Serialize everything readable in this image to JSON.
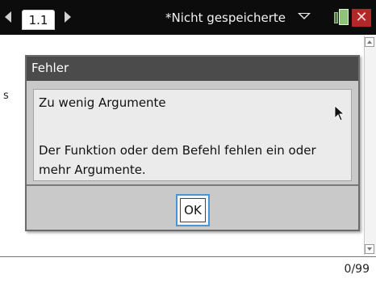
{
  "topbar": {
    "tab_label": "1.1",
    "document_title": "*Nicht gespeicherte"
  },
  "workarea": {
    "prompt_text": "s"
  },
  "dialog": {
    "title": "Fehler",
    "message_heading": "Zu wenig Argumente",
    "message_line1": "Der Funktion oder dem Befehl fehlen ein oder",
    "message_line2": "mehr Argumente.",
    "ok_label": "OK"
  },
  "statusbar": {
    "counter": "0/99"
  },
  "colors": {
    "topbar_bg": "#0c0c0c",
    "dialog_title_bg": "#4b4b4b",
    "dialog_bg": "#c9c9c9",
    "ok_focus_ring": "#4c94d0",
    "close_red": "#b22828",
    "cursor_red": "#c0203a"
  },
  "icons": {
    "nav_left": "chevron-left-icon",
    "nav_right": "chevron-right-icon",
    "doc_menu": "chevron-down-icon",
    "battery": "battery-icon",
    "close": "close-icon",
    "pointer": "mouse-pointer-icon",
    "scroll_up": "scroll-up-icon",
    "scroll_down": "scroll-down-icon"
  }
}
